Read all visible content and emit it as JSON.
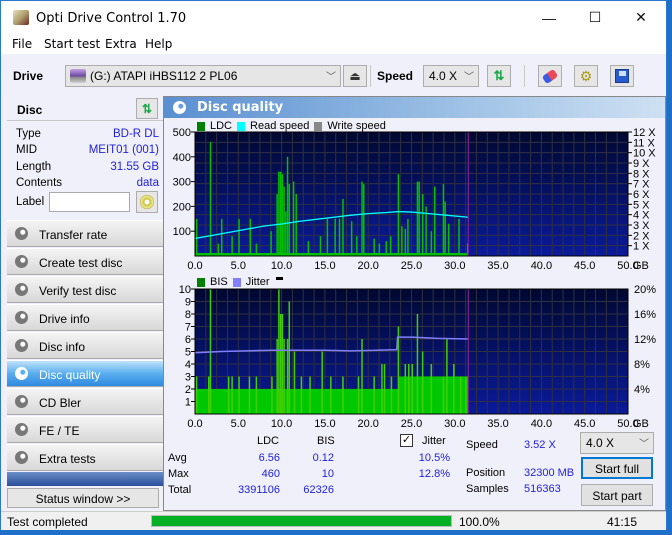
{
  "window": {
    "title": "Opti Drive Control 1.70",
    "controls": {
      "minimize": "—",
      "maximize": "☐",
      "close": "✕"
    }
  },
  "menu": [
    "File",
    "Start test",
    "Extra",
    "Help"
  ],
  "toolbar": {
    "drive_label": "Drive",
    "drive_value": "(G:)   ATAPI iHBS112   2 PL06",
    "speed_label": "Speed",
    "speed_value": "4.0 X",
    "icons": [
      "drive-icon",
      "eject-icon",
      "refresh-icon",
      "erase-icon",
      "settings-icon",
      "save-icon"
    ]
  },
  "disc": {
    "header": "Disc",
    "rows": [
      {
        "label": "Type",
        "value": "BD-R DL"
      },
      {
        "label": "MID",
        "value": "MEIT01 (001)"
      },
      {
        "label": "Length",
        "value": "31.55 GB"
      },
      {
        "label": "Contents",
        "value": "data"
      }
    ],
    "label_field_label": "Label",
    "label_field_value": ""
  },
  "nav": [
    {
      "label": "Transfer rate",
      "active": false
    },
    {
      "label": "Create test disc",
      "active": false
    },
    {
      "label": "Verify test disc",
      "active": false
    },
    {
      "label": "Drive info",
      "active": false
    },
    {
      "label": "Disc info",
      "active": false
    },
    {
      "label": "Disc quality",
      "active": true
    },
    {
      "label": "CD Bler",
      "active": false
    },
    {
      "label": "FE / TE",
      "active": false
    },
    {
      "label": "Extra tests",
      "active": false
    }
  ],
  "status_window_button": "Status window >>",
  "panel": {
    "title": "Disc quality"
  },
  "chart_data": [
    {
      "type": "bar",
      "title": "LDC",
      "legend": [
        "LDC",
        "Read speed",
        "Write speed"
      ],
      "legend_colors": {
        "LDC": "#00c000",
        "Read speed": "#00ffff",
        "Write speed": "#888888"
      },
      "xlabel": "GB",
      "xlim": [
        0,
        50
      ],
      "x_ticks": [
        "0.0",
        "5.0",
        "10.0",
        "15.0",
        "20.0",
        "25.0",
        "30.0",
        "35.0",
        "40.0",
        "45.0",
        "50.0"
      ],
      "ylim_left": [
        0,
        500
      ],
      "y_ticks_left": [
        "100",
        "200",
        "300",
        "400",
        "500"
      ],
      "ylim_right": [
        0,
        12
      ],
      "y_ticks_right": [
        "1 X",
        "2 X",
        "3 X",
        "4 X",
        "5 X",
        "6 X",
        "7 X",
        "8 X",
        "9 X",
        "10 X",
        "11 X",
        "12 X"
      ],
      "disc_end_gb": 31.55,
      "ldc_spikes": [
        [
          0.1,
          150
        ],
        [
          1.7,
          460
        ],
        [
          2.6,
          50
        ],
        [
          3.0,
          150
        ],
        [
          4.2,
          80
        ],
        [
          5.0,
          150
        ],
        [
          6.3,
          150
        ],
        [
          7.0,
          50
        ],
        [
          8.7,
          100
        ],
        [
          9.4,
          250
        ],
        [
          9.6,
          340
        ],
        [
          9.8,
          340
        ],
        [
          10.0,
          330
        ],
        [
          10.2,
          280
        ],
        [
          10.4,
          180
        ],
        [
          10.6,
          400
        ],
        [
          10.8,
          290
        ],
        [
          11.3,
          300
        ],
        [
          11.6,
          250
        ],
        [
          13.0,
          60
        ],
        [
          14.4,
          80
        ],
        [
          15.2,
          150
        ],
        [
          16.1,
          150
        ],
        [
          16.6,
          150
        ],
        [
          17.0,
          230
        ],
        [
          18.0,
          140
        ],
        [
          18.6,
          80
        ],
        [
          19.2,
          300
        ],
        [
          19.4,
          290
        ],
        [
          20.6,
          70
        ],
        [
          21.2,
          50
        ],
        [
          22.0,
          60
        ],
        [
          22.5,
          80
        ],
        [
          23.4,
          330
        ],
        [
          23.8,
          120
        ],
        [
          24.2,
          110
        ],
        [
          24.5,
          150
        ],
        [
          25.6,
          300
        ],
        [
          25.8,
          300
        ],
        [
          26.2,
          250
        ],
        [
          26.6,
          200
        ],
        [
          27.2,
          100
        ],
        [
          27.6,
          280
        ],
        [
          28.6,
          290
        ],
        [
          28.8,
          220
        ],
        [
          29.2,
          130
        ],
        [
          30.4,
          150
        ],
        [
          31.4,
          50
        ]
      ],
      "ldc_baseline": 12,
      "read_speed": [
        [
          0,
          1.7
        ],
        [
          2,
          2.0
        ],
        [
          4,
          2.3
        ],
        [
          6,
          2.6
        ],
        [
          8,
          2.9
        ],
        [
          10,
          3.1
        ],
        [
          12,
          3.35
        ],
        [
          14,
          3.55
        ],
        [
          16,
          3.75
        ],
        [
          18,
          3.95
        ],
        [
          20,
          4.1
        ],
        [
          22,
          4.2
        ],
        [
          23.5,
          4.3
        ],
        [
          25,
          4.25
        ],
        [
          27,
          4.1
        ],
        [
          29,
          3.95
        ],
        [
          31.55,
          3.75
        ]
      ]
    },
    {
      "type": "bar",
      "title": "BIS",
      "legend": [
        "BIS",
        "Jitter"
      ],
      "legend_colors": {
        "BIS": "#00c000",
        "Jitter": "#8080ff"
      },
      "xlabel": "GB",
      "xlim": [
        0,
        50
      ],
      "x_ticks": [
        "0.0",
        "5.0",
        "10.0",
        "15.0",
        "20.0",
        "25.0",
        "30.0",
        "35.0",
        "40.0",
        "45.0",
        "50.0"
      ],
      "ylim_left": [
        0,
        10
      ],
      "y_ticks_left": [
        "1",
        "2",
        "3",
        "4",
        "5",
        "6",
        "7",
        "8",
        "9",
        "10"
      ],
      "ylim_right": [
        0,
        20
      ],
      "y_ticks_right": [
        "4%",
        "8%",
        "12%",
        "16%",
        "20%"
      ],
      "disc_end_gb": 31.55,
      "bis_baseline": 2,
      "bis_spikes": [
        [
          0.1,
          3
        ],
        [
          1.5,
          3
        ],
        [
          1.7,
          10
        ],
        [
          3.8,
          3
        ],
        [
          4.2,
          3
        ],
        [
          5.0,
          3
        ],
        [
          6.2,
          3
        ],
        [
          7.0,
          3
        ],
        [
          8.8,
          3
        ],
        [
          9.4,
          6
        ],
        [
          9.6,
          10
        ],
        [
          9.8,
          8
        ],
        [
          10.0,
          8
        ],
        [
          10.2,
          6
        ],
        [
          10.6,
          6
        ],
        [
          10.8,
          9
        ],
        [
          11.4,
          5
        ],
        [
          12.2,
          3
        ],
        [
          13.2,
          3
        ],
        [
          14.6,
          5
        ],
        [
          15.6,
          3
        ],
        [
          17.0,
          3
        ],
        [
          18.8,
          3
        ],
        [
          19.2,
          6
        ],
        [
          20.6,
          3
        ],
        [
          21.5,
          4
        ],
        [
          21.8,
          4
        ],
        [
          22.6,
          3
        ],
        [
          23.4,
          7
        ],
        [
          24.2,
          4
        ],
        [
          24.6,
          4
        ],
        [
          25.0,
          4
        ],
        [
          25.6,
          8
        ],
        [
          26.2,
          5
        ],
        [
          27.2,
          4
        ],
        [
          28.6,
          3
        ],
        [
          29.0,
          6
        ],
        [
          29.8,
          4
        ],
        [
          30.6,
          3
        ],
        [
          31.2,
          3
        ]
      ],
      "bis_high_region": [
        [
          23.5,
          31.55,
          3
        ]
      ],
      "jitter_pct": [
        [
          0,
          9.8
        ],
        [
          3,
          10.0
        ],
        [
          6,
          10.1
        ],
        [
          9,
          10.2
        ],
        [
          12,
          10.2
        ],
        [
          15,
          10.2
        ],
        [
          18,
          10.1
        ],
        [
          21,
          10.2
        ],
        [
          23.3,
          10.3
        ],
        [
          23.4,
          12.3
        ],
        [
          25,
          12.3
        ],
        [
          28,
          12.1
        ],
        [
          31.55,
          12.0
        ]
      ]
    }
  ],
  "stats": {
    "col_ldc": "LDC",
    "col_bis": "BIS",
    "jitter_label": "Jitter",
    "jitter_checked": true,
    "rows": [
      {
        "label": "Avg",
        "ldc": "6.56",
        "bis": "0.12",
        "jitter": "10.5%"
      },
      {
        "label": "Max",
        "ldc": "460",
        "bis": "10",
        "jitter": "12.8%"
      },
      {
        "label": "Total",
        "ldc": "3391106",
        "bis": "62326",
        "jitter": ""
      }
    ],
    "speed_label": "Speed",
    "speed_value": "3.52 X",
    "position_label": "Position",
    "position_value": "32300 MB",
    "samples_label": "Samples",
    "samples_value": "516363",
    "speed_select": "4.0 X",
    "start_full": "Start full",
    "start_part": "Start part"
  },
  "statusbar": {
    "text": "Test completed",
    "progress_percent": 100,
    "progress_text": "100.0%",
    "time": "41:15"
  }
}
